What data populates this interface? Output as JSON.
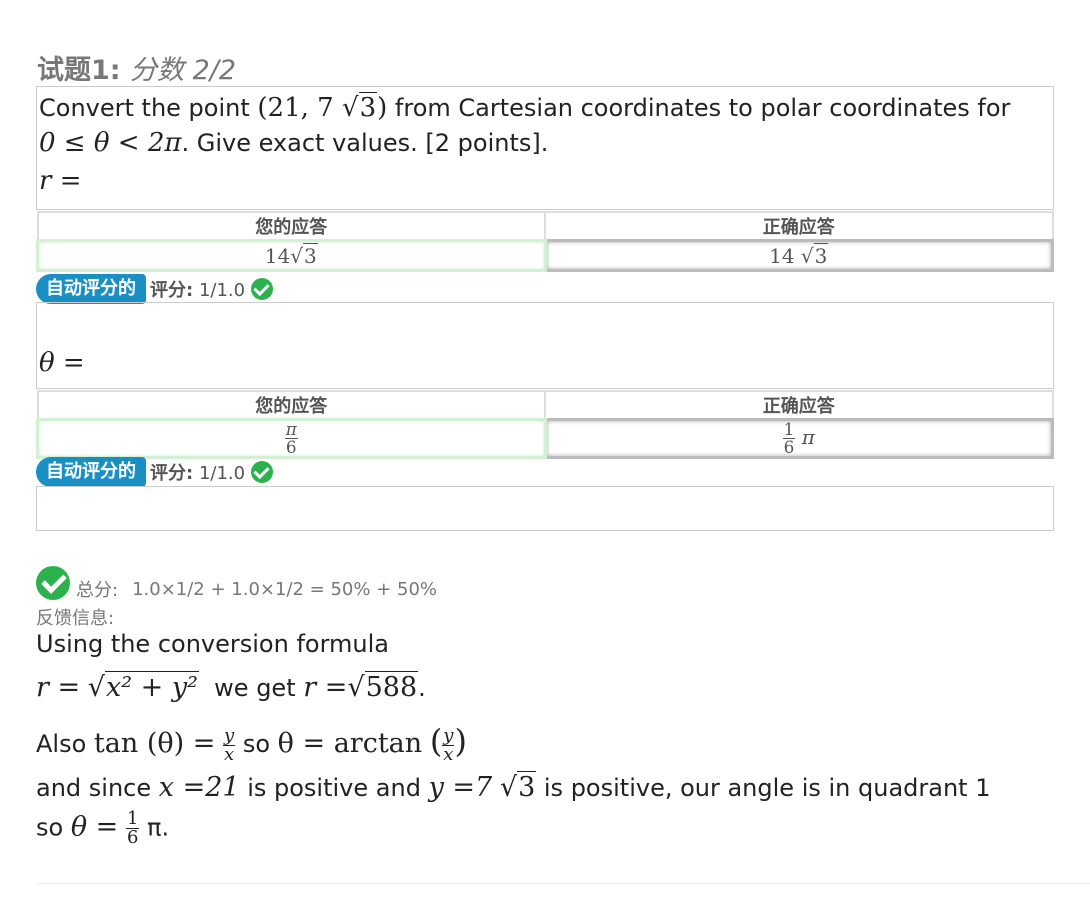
{
  "question": {
    "title_label": "试题1:",
    "title_score": "分数 2/2",
    "text_part1": "Convert the point",
    "point_x": "21",
    "point_y_coef": "7",
    "point_y_rad": "3",
    "text_part2": "from Cartesian coordinates to polar coordinates for",
    "text_range": "0 ≤ θ < 2π",
    "text_part3": ". Give exact values. [2 points].",
    "r_label": "r  ="
  },
  "answer_r": {
    "header_yours": "您的应答",
    "header_correct": "正确应答",
    "yours_coef": "14",
    "yours_rad": "3",
    "correct_coef": "14",
    "correct_rad": "3",
    "badge": "自动评分的",
    "score_label": "评分:",
    "score_value": "1/1.0"
  },
  "theta_label": "θ  =",
  "answer_theta": {
    "header_yours": "您的应答",
    "header_correct": "正确应答",
    "yours_num": "π",
    "yours_den": "6",
    "correct_num": "1",
    "correct_den": "6",
    "correct_suffix": "π",
    "badge": "自动评分的",
    "score_label": "评分:",
    "score_value": "1/1.0"
  },
  "total": {
    "label": "总分:",
    "value": "1.0×1/2 + 1.0×1/2 = 50% + 50%"
  },
  "feedback": {
    "label": "反馈信息:",
    "line1": "Using the conversion formula",
    "line2_formula_lhs": "r =",
    "line2_formula_rad": "x² + y²",
    "line2_text": "we get",
    "line2_result_lhs": "r =",
    "line2_result_rad": "588",
    "line2_end": ".",
    "line3_also": "Also",
    "line3_tan": "tan (θ) =",
    "line3_num": "y",
    "line3_den": "x",
    "line3_so": "so",
    "line3_theta": "θ = arctan",
    "line4_a": "and since",
    "line4_x": "x =21",
    "line4_b": "is positive and",
    "line4_y": "y =7",
    "line4_yrad": "3",
    "line4_c": "is positive, our angle is in quadrant 1",
    "line5_so": "so",
    "line5_theta": "θ  =",
    "line5_num": "1",
    "line5_den": "6",
    "line5_pi": "π."
  },
  "colors": {
    "badge": "#1a8fc4",
    "check": "#2bb24c"
  }
}
